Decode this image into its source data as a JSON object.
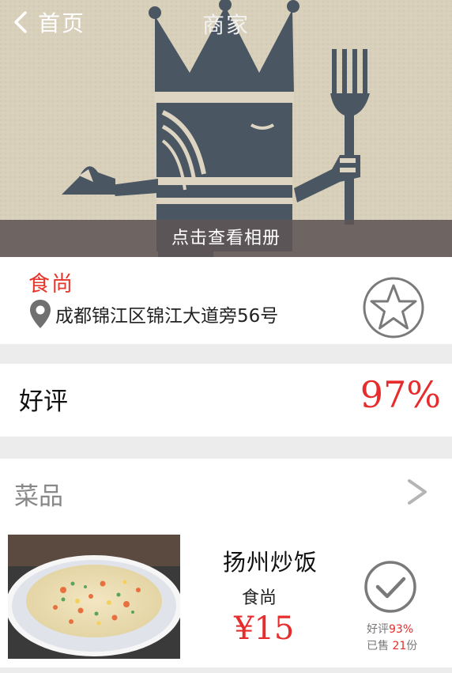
{
  "nav": {
    "back_label": "首页",
    "title": "商家"
  },
  "hero": {
    "album_label": "点击查看相册"
  },
  "shop": {
    "name": "食尚",
    "address": "成都锦江区锦江大道旁56号"
  },
  "rating": {
    "label": "好评",
    "value": "97%"
  },
  "dishes": {
    "label": "菜品",
    "items": [
      {
        "name": "扬州炒饭",
        "shop": "食尚",
        "price": "¥15",
        "rating_prefix": "好评",
        "rating_value": "93%",
        "sold_prefix": "已售",
        "sold_value": "21",
        "sold_unit": "份"
      }
    ]
  },
  "colors": {
    "accent_red": "#e62c2c",
    "album_bar": "#5f5555",
    "icon_gray": "#7a7a7a"
  },
  "icons": [
    "chevron-left-icon",
    "location-pin-icon",
    "star-icon",
    "chevron-right-icon",
    "check-icon"
  ]
}
